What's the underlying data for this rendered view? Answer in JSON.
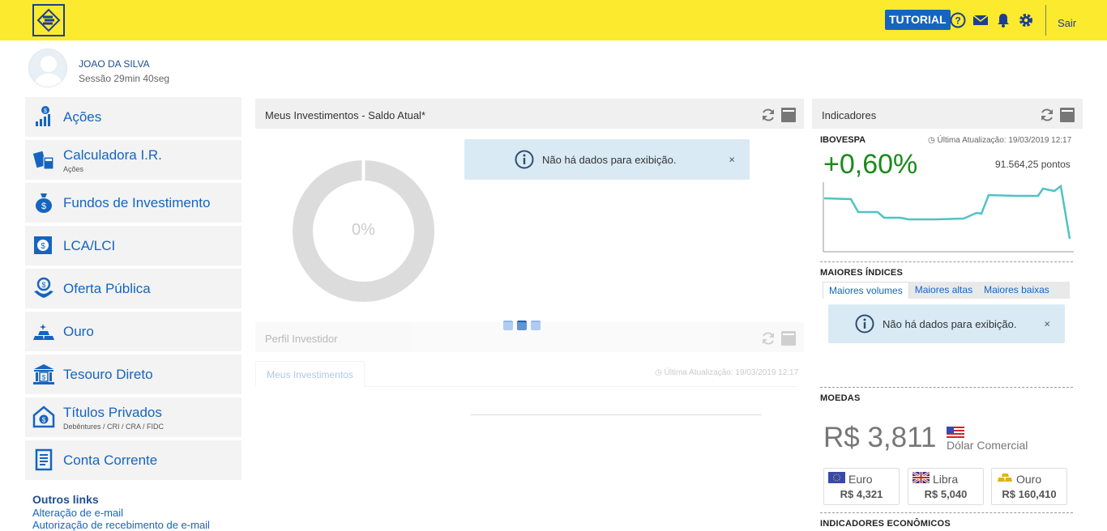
{
  "header": {
    "tutorial_label": "TUTORIAL",
    "logout_label": "Sair"
  },
  "user": {
    "name": "JOAO DA SILVA",
    "session": "Sessão 29min 40seg"
  },
  "sidebar": {
    "items": [
      {
        "label": "Ações",
        "sub": ""
      },
      {
        "label": "Calculadora I.R.",
        "sub": "Ações"
      },
      {
        "label": "Fundos de Investimento",
        "sub": ""
      },
      {
        "label": "LCA/LCI",
        "sub": ""
      },
      {
        "label": "Oferta Pública",
        "sub": ""
      },
      {
        "label": "Ouro",
        "sub": ""
      },
      {
        "label": "Tesouro Direto",
        "sub": ""
      },
      {
        "label": "Títulos Privados",
        "sub": "Debêntures / CRI / CRA / FIDC"
      },
      {
        "label": "Conta Corrente",
        "sub": ""
      }
    ],
    "outros_title": "Outros links",
    "links": [
      "Alteração de e-mail",
      "Autorização de recebimento de e-mail"
    ]
  },
  "investments": {
    "title": "Meus Investimentos - Saldo Atual*",
    "donut_value": "0%",
    "alert": "Não há dados para exibição.",
    "alert_close": "×"
  },
  "perfil": {
    "title": "Perfil Investidor",
    "tab": "Meus Investimentos",
    "updated": "Última Atualização: 19/03/2019 12:17"
  },
  "indicadores": {
    "title": "Indicadores",
    "ibovespa_label": "IBOVESPA",
    "updated": "Última Atualização: 19/03/2019 12:17",
    "ibovespa_change": "+0,60%",
    "ibovespa_points": "91.564,25 pontos",
    "maiores_title": "MAIORES ÍNDICES",
    "tabs": [
      "Maiores volumes",
      "Maiores altas",
      "Maiores baixas"
    ],
    "alert": "Não há dados para exibição.",
    "alert_close": "×",
    "moedas_title": "MOEDAS",
    "main_rate": "R$ 3,811",
    "main_rate_name": "Dólar Comercial",
    "currencies": [
      {
        "name": "Euro",
        "value": "R$ 4,321"
      },
      {
        "name": "Libra",
        "value": "R$ 5,040"
      },
      {
        "name": "Ouro",
        "value": "R$ 160,410"
      }
    ],
    "economicos_title": "INDICADORES ECONÔMICOS"
  },
  "colors": {
    "brand_yellow": "#fcea2f",
    "brand_blue": "#1565c0",
    "positive_green": "#1b8a1b",
    "chart_line": "#4fc3c3"
  }
}
